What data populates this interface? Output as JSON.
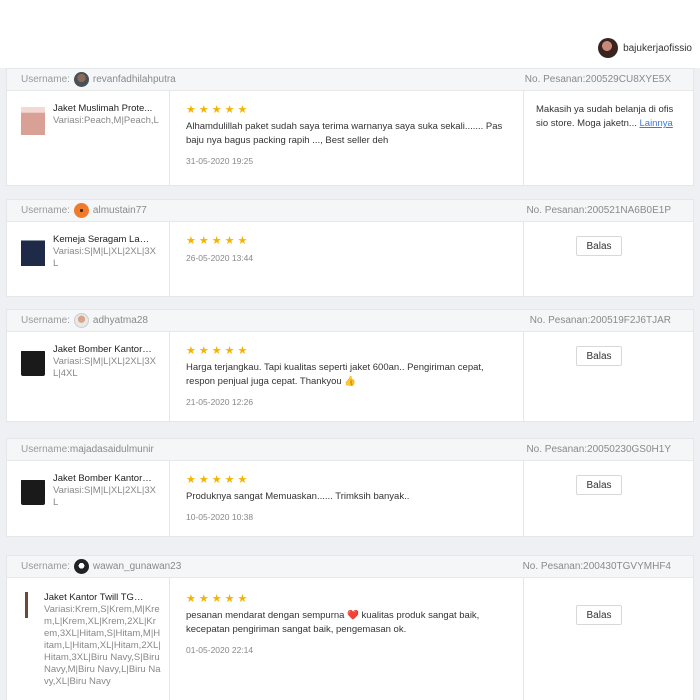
{
  "account": {
    "name": "bajukerjaofissio"
  },
  "reviews": [
    {
      "username_prefix": "Username:",
      "username": "revanfadhilahputra",
      "order": "No. Pesanan:200529CU8XYE5X",
      "product": {
        "name": "Jaket Muslimah Prote...",
        "variation": "Variasi:Peach,M|Peach,L"
      },
      "stars": "★★★★★",
      "text": "Alhamdulillah paket sudah saya terima warnanya saya suka sekali....... Pas baju nya bagus packing rapih ..., Best seller deh",
      "date": "31-05-2020 19:25",
      "reply": {
        "text": "Makasih ya sudah belanja di ofis sio store. Moga jaketn...",
        "link": "Lainnya"
      }
    },
    {
      "username_prefix": "Username:",
      "username": "almustain77",
      "order": "No. Pesanan:200521NA6B0E1P",
      "product": {
        "name": "Kemeja Seragam Lapa...",
        "variation": "Variasi:S|M|L|XL|2XL|3XL"
      },
      "stars": "★★★★★",
      "text": "",
      "date": "26-05-2020 13:44",
      "reply_button": "Balas"
    },
    {
      "username_prefix": "Username:",
      "username": "adhyatma28",
      "order": "No. Pesanan:200519F2J6TJAR",
      "product": {
        "name": "Jaket Bomber Kantor-...",
        "variation": "Variasi:S|M|L|XL|2XL|3XL|4XL"
      },
      "stars": "★★★★★",
      "text": "Harga terjangkau. Tapi kualitas seperti jaket 600an.. Pengiriman cepat, respon penjual juga cepat. Thankyou 👍",
      "date": "21-05-2020 12:26",
      "reply_button": "Balas"
    },
    {
      "username_prefix": "Username:",
      "username": "majadasaidulmunir",
      "order": "No. Pesanan:20050230GS0H1Y",
      "product": {
        "name": "Jaket Bomber Kantor-...",
        "variation": "Variasi:S|M|L|XL|2XL|3XL"
      },
      "stars": "★★★★★",
      "text": "Produknya sangat Memuaskan...... Trimksih banyak..",
      "date": "10-05-2020 10:38",
      "reply_button": "Balas"
    },
    {
      "username_prefix": "Username:",
      "username": "wawan_gunawan23",
      "order": "No. Pesanan:200430TGVYMHF4",
      "product": {
        "name": "Jaket Kantor Twill TG0...",
        "variation": "Variasi:Krem,S|Krem,M|Krem,L|Krem,XL|Krem,2XL|Krem,3XL|Hitam,S|Hitam,M|Hitam,L|Hitam,XL|Hitam,2XL|Hitam,3XL|Biru Navy,S|Biru Navy,M|Biru Navy,L|Biru Navy,XL|Biru Navy"
      },
      "stars": "★★★★★",
      "text": "pesanan mendarat dengan sempurna ❤️ kualitas produk sangat baik, kecepatan pengiriman sangat baik, pengemasan ok.",
      "date": "01-05-2020 22:14",
      "reply_button": "Balas"
    }
  ]
}
